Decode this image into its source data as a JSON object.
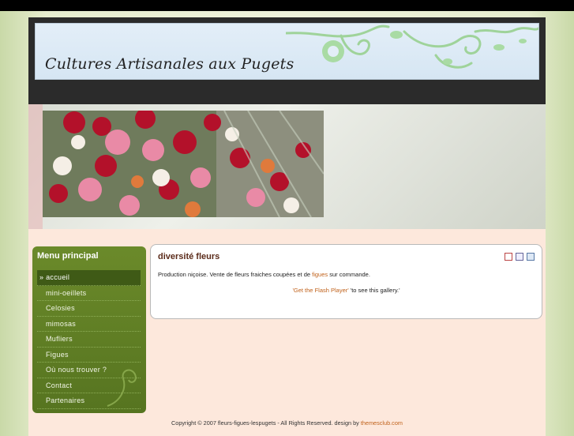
{
  "site": {
    "title": "Cultures Artisanales aux Pugets"
  },
  "menu": {
    "title": "Menu principal",
    "items": [
      {
        "label": "» accueil",
        "active": true
      },
      {
        "label": "mini-oeillets"
      },
      {
        "label": "Celosies"
      },
      {
        "label": "mimosas"
      },
      {
        "label": "Mufliers"
      },
      {
        "label": "Figues"
      },
      {
        "label": "Où nous trouver ?"
      },
      {
        "label": "Contact"
      },
      {
        "label": "Partenaires"
      }
    ]
  },
  "article": {
    "title": "diversité fleurs",
    "text_before": "Production  niçoise.  Vente de fleurs fraiches coupées et  de ",
    "link": "figues",
    "text_after": " sur commande.",
    "gallery_link": "'Get the Flash Player'",
    "gallery_text": " 'to see this gallery.'"
  },
  "footer": {
    "text": "Copyright © 2007 fleurs-figues-lespugets  -  All Rights Reserved. design by ",
    "link": "themesclub.com"
  },
  "icons": [
    "pdf-icon",
    "print-icon",
    "email-icon"
  ],
  "colors": {
    "menu_bg": "#5f7f25",
    "accent_link": "#c0611a",
    "header_bg": "#2b2b2b",
    "page_bg": "#fde8dc"
  }
}
